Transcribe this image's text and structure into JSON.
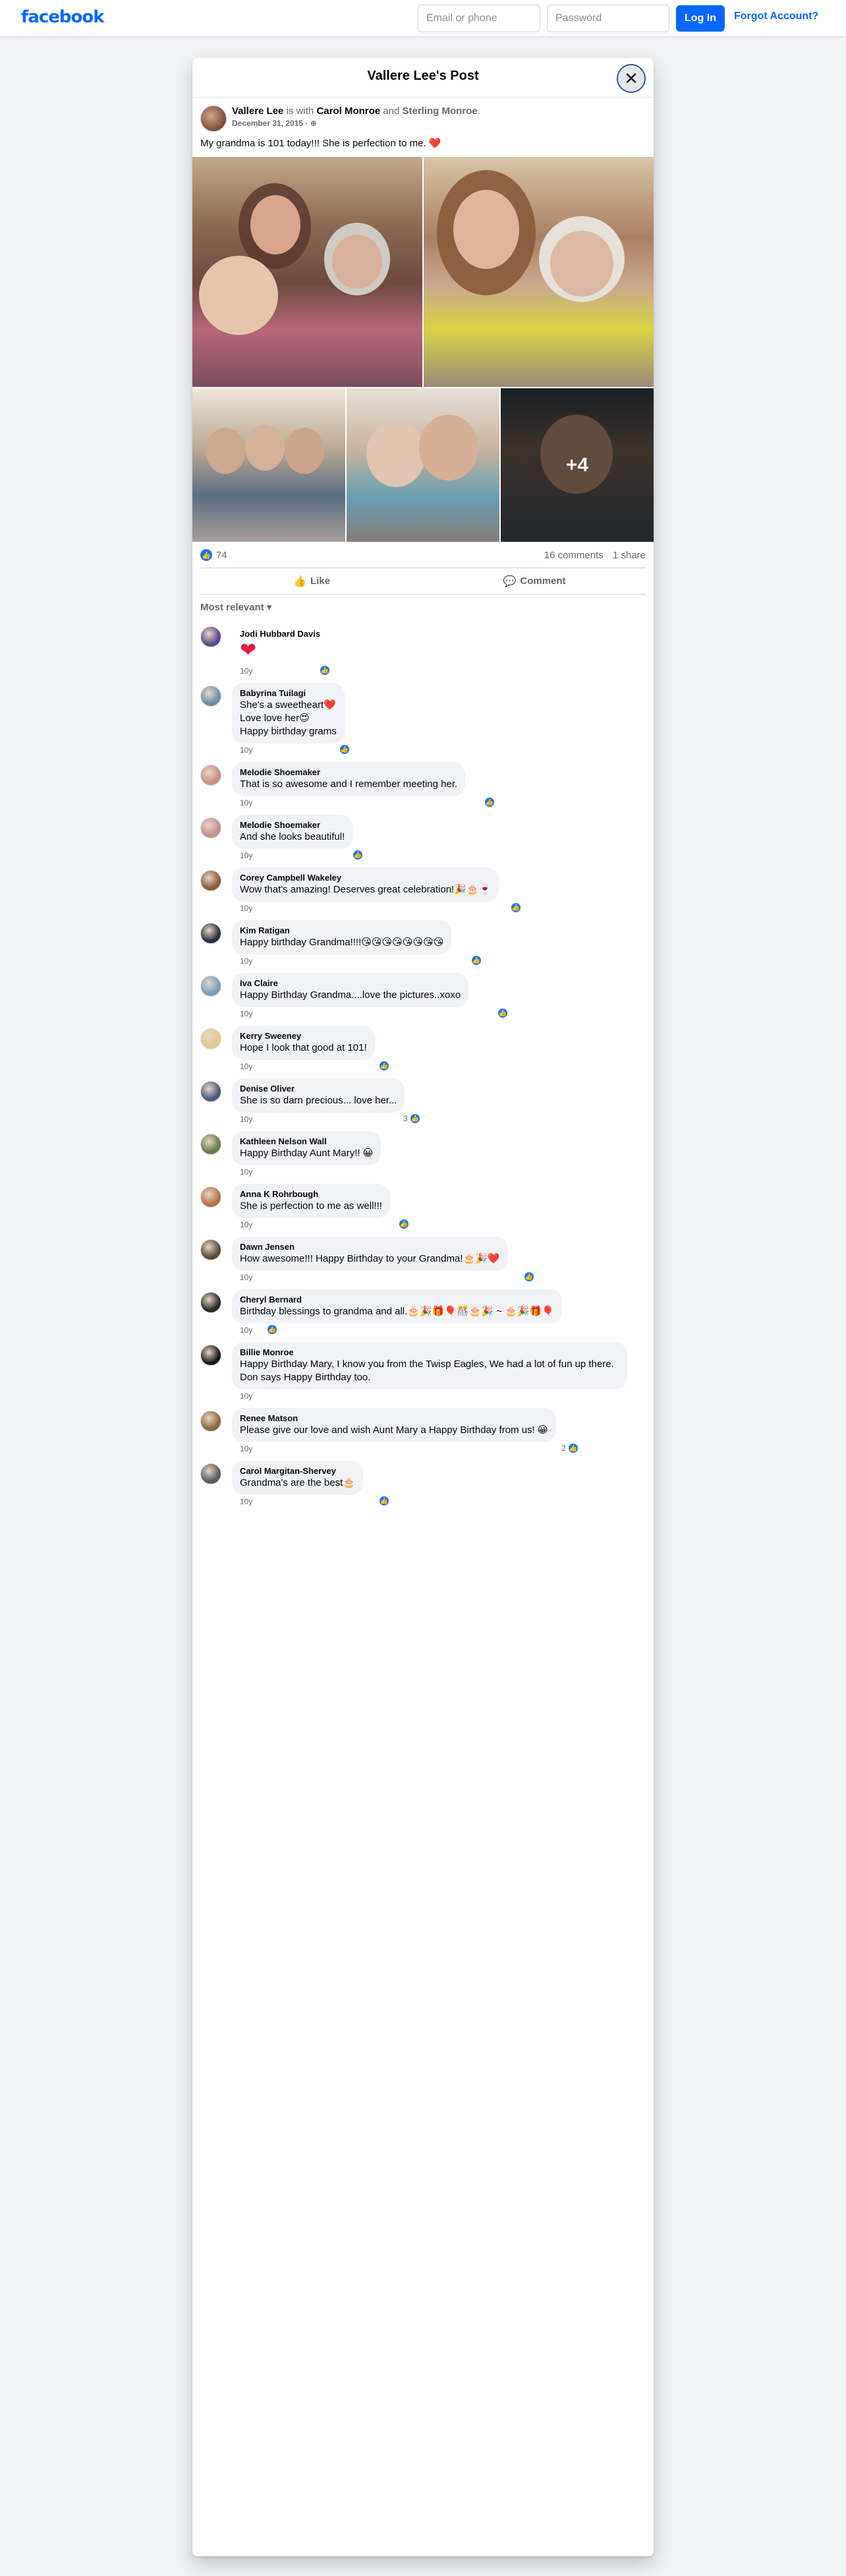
{
  "nav": {
    "logo": "facebook",
    "email_placeholder": "Email or phone",
    "password_placeholder": "Password",
    "login_label": "Log In",
    "forgot_label": "Forgot Account?"
  },
  "dialog": {
    "title": "Vallere Lee's Post",
    "close_icon": "close-icon"
  },
  "post": {
    "author": "Vallere Lee",
    "with_text": "is with",
    "tagged_1": "Carol Monroe",
    "and_text": "and",
    "tagged_2": "Sterling Monroe",
    "date": "December 31, 2015 · ",
    "privacy_icon": "globe-icon",
    "text": "My grandma is 101 today!!! She is perfection to me. ",
    "text_emoji": "❤️",
    "more_photos": "+4",
    "like_count": "74",
    "comments_count": "16 comments",
    "shares_count": "1 share",
    "like_label": "Like",
    "comment_label": "Comment",
    "sort_label": "Most relevant"
  },
  "comments": [
    {
      "name": "Jodi Hubbard Davis",
      "text": "",
      "big_heart": "❤",
      "time": "10y",
      "reactions": "",
      "avatar_color": "#5b4a8b"
    },
    {
      "name": "Babyrina Tuilagi",
      "text": "She's a sweetheart❤️\nLove love her😍\nHappy birthday grams",
      "time": "10y",
      "reactions": "",
      "avatar_color": "#6b8fa8"
    },
    {
      "name": "Melodie Shoemaker",
      "text": "That is so awesome and I remember meeting her.",
      "time": "10y",
      "reactions": "",
      "avatar_color": "#c98f8a"
    },
    {
      "name": "Melodie Shoemaker",
      "text": "And she looks beautiful!",
      "time": "10y",
      "reactions": "",
      "avatar_color": "#c98f8a"
    },
    {
      "name": "Corey Campbell Wakeley",
      "text": "Wow that's amazing! Deserves great celebration!🎉🎂🍷",
      "time": "10y",
      "reactions": "",
      "avatar_color": "#8a5a3c"
    },
    {
      "name": "Kim Ratigan",
      "text": "Happy birthday Grandma!!!!😘😘😘😘😘😘😘😘",
      "time": "10y",
      "reactions": "",
      "avatar_color": "#2b2f3a"
    },
    {
      "name": "Iva Claire",
      "text": "Happy Birthday Grandma....love the pictures..xoxo",
      "time": "10y",
      "reactions": "",
      "avatar_color": "#7a9cb8"
    },
    {
      "name": "Kerry Sweeney",
      "text": "Hope I look that good at 101!",
      "time": "10y",
      "reactions": "",
      "avatar_color": "#e0c98a"
    },
    {
      "name": "Denise Oliver",
      "text": "She is so darn precious... love her...",
      "time": "10y",
      "reactions": "3",
      "avatar_color": "#4a5a7a"
    },
    {
      "name": "Kathleen Nelson Wall",
      "text": "Happy Birthday Aunt Mary!! 😀",
      "time": "10y",
      "reactions": "",
      "avatar_color": "#6a7a4a"
    },
    {
      "name": "Anna K Rohrbough",
      "text": "She is perfection to me as well!!!",
      "time": "10y",
      "reactions": "",
      "avatar_color": "#b0744a"
    },
    {
      "name": "Dawn Jensen",
      "text": "How awesome!!! Happy Birthday to your Grandma!🎂🎉❤️",
      "time": "10y",
      "reactions": "",
      "avatar_color": "#5a4a3a"
    },
    {
      "name": "Cheryl Bernard",
      "text": "Birthday blessings to grandma and all.🎂🎉🎁🎈🎊🎂🎉 ~ 🎂🎉🎁🎈",
      "time": "10y",
      "reactions": "",
      "avatar_color": "#2a2a2a"
    },
    {
      "name": "Billie Monroe",
      "text": "Happy Birthday Mary, I know you from the Twisp Eagles, We had a lot of fun up there. Don says Happy Birthday too.",
      "time": "10y",
      "reactions": "",
      "avatar_color": "#1a1a1a"
    },
    {
      "name": "Renee Matson",
      "text": "Please give our love and wish Aunt Mary a Happy Birthday from us! 😀",
      "time": "10y",
      "reactions": "2",
      "avatar_color": "#8a6a3a"
    },
    {
      "name": "Carol Margitan-Shervey",
      "text": "Grandma's are the best🎂",
      "time": "10y",
      "reactions": "",
      "avatar_color": "#5a5a5a"
    }
  ],
  "colors": {
    "brand": "#0866ff",
    "like_blue": "#1877f2",
    "heart_red": "#e41e3f"
  }
}
